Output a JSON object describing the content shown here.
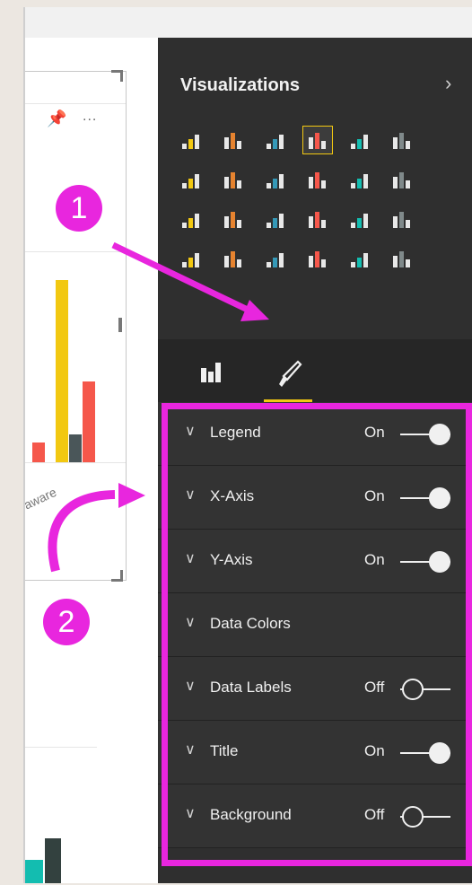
{
  "panel": {
    "title": "Visualizations",
    "collapse_icon": "chevron-right-icon"
  },
  "visual_header": {
    "pin_icon": "pin-icon",
    "more_label": "..."
  },
  "canvas": {
    "axis_label": "aware",
    "bars_colors": [
      "#f2c811",
      "#4a5659",
      "#f5574b",
      "#13bdb0"
    ]
  },
  "viz_icons": [
    "stacked-bar-chart-icon",
    "stacked-column-chart-icon",
    "clustered-bar-chart-icon",
    "clustered-column-chart-icon",
    "100-stacked-bar-chart-icon",
    "100-stacked-column-chart-icon",
    "line-chart-icon",
    "area-chart-icon",
    "line-stacked-column-icon",
    "line-clustered-column-icon",
    "ribbon-chart-icon",
    "scatter-chart-icon",
    "pie-chart-icon",
    "treemap-icon",
    "globe-map-icon",
    "table-icon",
    "matrix-icon",
    "filled-map-icon",
    "funnel-icon",
    "gauge-icon",
    "multi-row-card-icon",
    "card-icon",
    "kpi-icon",
    "slicer-icon"
  ],
  "selected_viz_index": 3,
  "tabs": {
    "fields_icon": "fields-icon",
    "format_icon": "paint-roller-icon"
  },
  "settings": [
    {
      "label": "Legend",
      "state": "On"
    },
    {
      "label": "X-Axis",
      "state": "On"
    },
    {
      "label": "Y-Axis",
      "state": "On"
    },
    {
      "label": "Data Colors",
      "state": ""
    },
    {
      "label": "Data Labels",
      "state": "Off"
    },
    {
      "label": "Title",
      "state": "On"
    },
    {
      "label": "Background",
      "state": "Off"
    }
  ],
  "annotations": {
    "step1": "1",
    "step2": "2",
    "accent": "#e826de"
  },
  "colors": {
    "panel_bg": "#2f2f2f",
    "highlight": "#f2c811"
  }
}
